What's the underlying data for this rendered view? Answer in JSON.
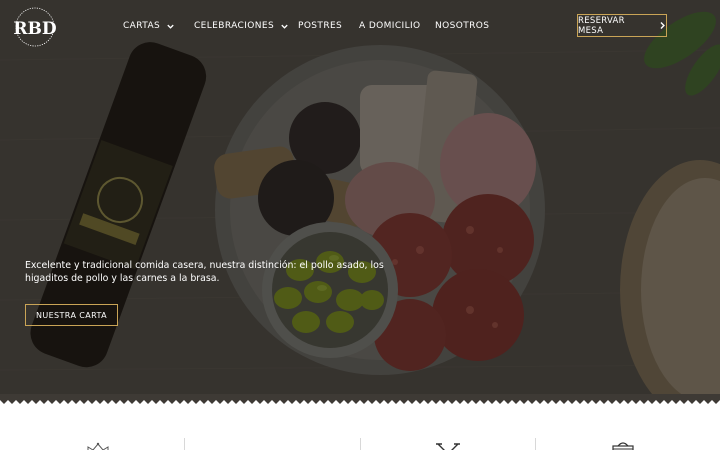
{
  "nav": {
    "logo_text": "RBD",
    "items": [
      {
        "label": "CARTAS",
        "has_dropdown": true
      },
      {
        "label": "CELEBRACIONES",
        "has_dropdown": true
      },
      {
        "label": "POSTRES",
        "has_dropdown": false
      },
      {
        "label": "A DOMICILIO",
        "has_dropdown": false
      },
      {
        "label": "NOSOTROS",
        "has_dropdown": false
      }
    ],
    "reserve_label": "RESERVAR MESA"
  },
  "hero": {
    "description": "Excelente y tradicional comida casera, nuestra distinción: el pollo asado, los higaditos de pollo y las carnes a la brasa.",
    "cta_label": "NUESTRA CARTA"
  },
  "features": {
    "icons": [
      "crown-icon",
      "empty-slot",
      "crossed-utensils-icon",
      "takeaway-bag-icon"
    ]
  },
  "colors": {
    "accent_gold": "#c9a456",
    "hero_overlay": "#3e3a35",
    "text_light": "#ffffff"
  }
}
